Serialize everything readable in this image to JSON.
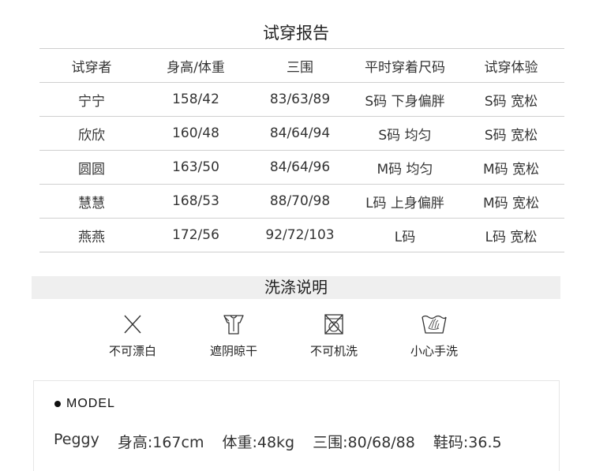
{
  "report": {
    "title": "试穿报告",
    "headers": [
      "试穿者",
      "身高/体重",
      "三围",
      "平时穿着尺码",
      "试穿体验"
    ],
    "rows": [
      [
        "宁宁",
        "158/42",
        "83/63/89",
        "S码 下身偏胖",
        "S码 宽松"
      ],
      [
        "欣欣",
        "160/48",
        "84/64/94",
        "S码 均匀",
        "S码 宽松"
      ],
      [
        "圆圆",
        "163/50",
        "84/64/96",
        "M码 均匀",
        "M码 宽松"
      ],
      [
        "慧慧",
        "168/53",
        "88/70/98",
        "L码 上身偏胖",
        "M码 宽松"
      ],
      [
        "燕燕",
        "172/56",
        "92/72/103",
        "L码",
        "L码 宽松"
      ]
    ]
  },
  "wash": {
    "title": "洗涤说明",
    "items": [
      {
        "icon": "no-bleach-icon",
        "label": "不可漂白"
      },
      {
        "icon": "shade-dry-icon",
        "label": "遮阴晾干"
      },
      {
        "icon": "no-machine-wash-icon",
        "label": "不可机洗"
      },
      {
        "icon": "hand-wash-icon",
        "label": "小心手洗"
      }
    ]
  },
  "model": {
    "title": "MODEL",
    "name": "Peggy",
    "height": "身高:167cm",
    "weight": "体重:48kg",
    "measurements": "三围:80/68/88",
    "shoe": "鞋码:36.5"
  }
}
